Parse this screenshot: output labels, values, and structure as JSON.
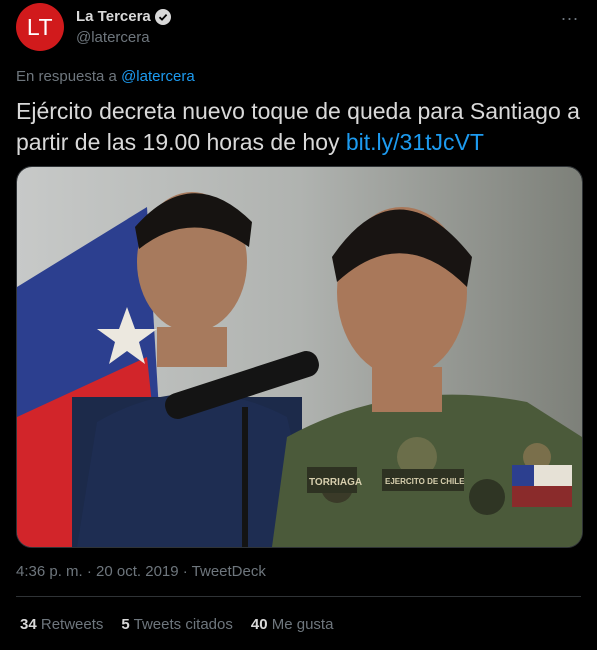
{
  "author": {
    "avatar_text": "LT",
    "name": "La Tercera",
    "handle": "@latercera",
    "avatar_color": "#d11a1c"
  },
  "more_icon": "...",
  "reply": {
    "prefix": "En respuesta a",
    "mention": "@latercera"
  },
  "tweet": {
    "text": "Ejército decreta nuevo toque de queda para Santiago a partir de las 19.00 horas de hoy",
    "link": "bit.ly/31tJcVT"
  },
  "media": {
    "patch_name": "TORRIAGA",
    "patch_unit": "EJERCITO DE CHILE"
  },
  "meta": "4:36 p. m. · 20 oct. 2019 · TweetDeck",
  "stats": {
    "retweets_count": "34",
    "retweets_label": "Retweets",
    "quotes_count": "5",
    "quotes_label": "Tweets citados",
    "likes_count": "40",
    "likes_label": "Me gusta"
  },
  "colors": {
    "background": "#000000",
    "link": "#1d9bf0",
    "muted": "#6e767d",
    "divider": "#2f3336"
  }
}
